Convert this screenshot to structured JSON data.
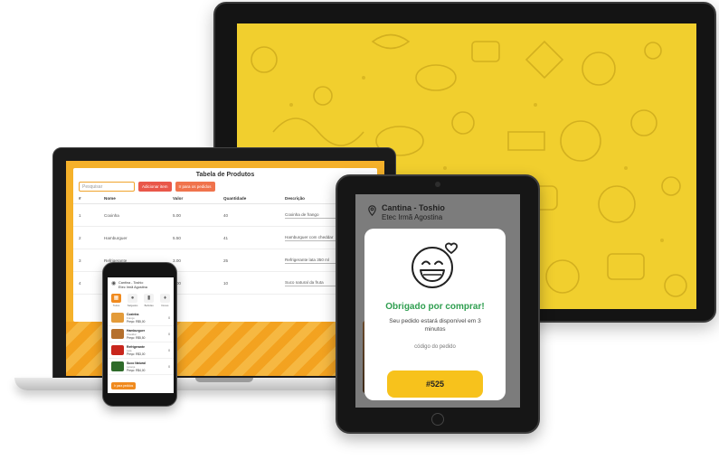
{
  "tablet_app": {
    "store_name": "Cantina - Toshio",
    "school_name": "Etec Irmã Agostina",
    "thanks_message": "Obrigado por comprar!",
    "order_status": "Seu pedido estará disponível em 3 minutos",
    "order_code_label": "código do pedido",
    "order_code": "#525",
    "accent_color": "#f7c21c",
    "success_color": "#2e9e4f"
  },
  "laptop_app": {
    "title": "Tabela de Produtos",
    "search_placeholder": "Pesquisar",
    "add_button_label": "Adicionar item",
    "orders_button_label": "Ir para os pedidos",
    "columns": [
      "#",
      "Nome",
      "Valor",
      "Quantidade",
      "Descrição"
    ],
    "rows": [
      {
        "id": "1",
        "name": "Coxinha",
        "price": "5.00",
        "qty": "40",
        "desc": "Coxinha de frango"
      },
      {
        "id": "2",
        "name": "Hamburguer",
        "price": "5.50",
        "qty": "41",
        "desc": "Hamburguer com cheddar"
      },
      {
        "id": "3",
        "name": "Refrigerante",
        "price": "3.00",
        "qty": "25",
        "desc": "Refrigerante lata 350 ml"
      },
      {
        "id": "4",
        "name": "Suco Natural",
        "price": "4.00",
        "qty": "10",
        "desc": "Suco natural da fruta"
      }
    ]
  },
  "phone_app": {
    "store_name": "Cantina - Toshio",
    "school_name": "Etec Irmã Agostina",
    "categories": [
      "Todos",
      "Salgados",
      "Bebidas",
      "Doces"
    ],
    "items": [
      {
        "name": "Coxinha",
        "desc": "Frango",
        "price": "Preço: R$5,00",
        "qty": "0"
      },
      {
        "name": "Hamburguer",
        "desc": "Cheddar",
        "price": "Preço: R$5,50",
        "qty": "0"
      },
      {
        "name": "Refrigerante",
        "desc": "Lata",
        "price": "Preço: R$3,00",
        "qty": "0"
      },
      {
        "name": "Suco Natural",
        "desc": "Laranja",
        "price": "Preço: R$4,00",
        "qty": "0"
      }
    ],
    "footer_label": "Ir para pedidos"
  },
  "theme": {
    "monitor_bg": "#f1cf2e",
    "laptop_bg": "#f5b12a"
  }
}
